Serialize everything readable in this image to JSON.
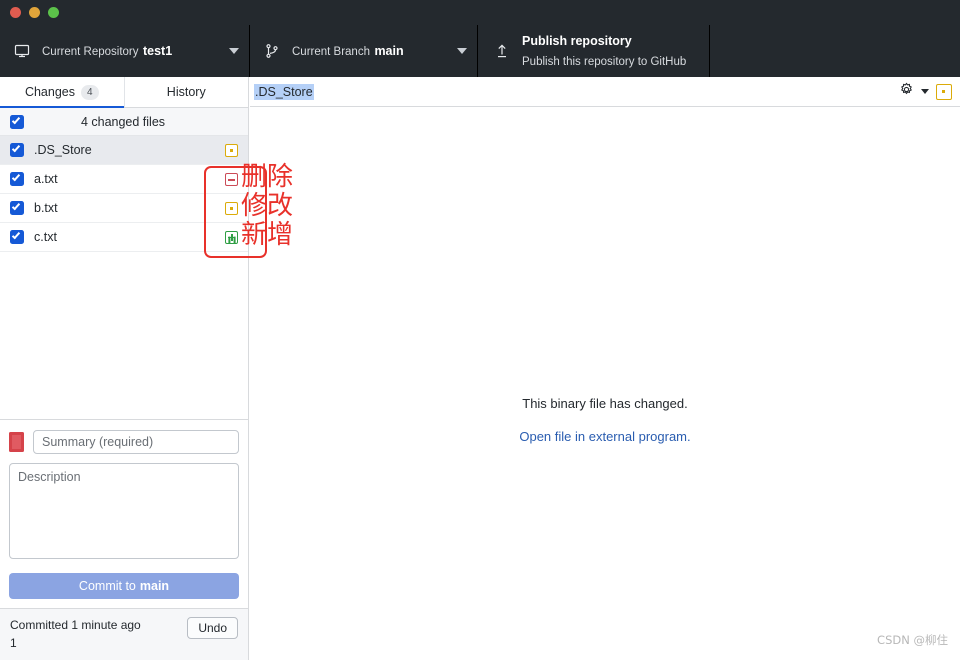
{
  "window": {
    "traffic_lights": [
      {
        "name": "close",
        "color": "#e05c50"
      },
      {
        "name": "minimize",
        "color": "#e0a43a"
      },
      {
        "name": "maximize",
        "color": "#5cc24a"
      }
    ]
  },
  "toolbar": {
    "repository": {
      "icon": "desktop-icon",
      "label": "Current Repository",
      "value": "test1"
    },
    "branch": {
      "icon": "git-branch-icon",
      "label": "Current Branch",
      "value": "main"
    },
    "publish": {
      "icon": "upload-icon",
      "title": "Publish repository",
      "subtitle": "Publish this repository to GitHub"
    }
  },
  "sidebar": {
    "tabs": [
      {
        "label": "Changes",
        "badge": "4",
        "active": true
      },
      {
        "label": "History",
        "badge": "",
        "active": false
      }
    ],
    "changed_header": "4 changed files",
    "files": [
      {
        "name": ".DS_Store",
        "status": "modified",
        "selected": true
      },
      {
        "name": "a.txt",
        "status": "deleted",
        "selected": false
      },
      {
        "name": "b.txt",
        "status": "modified",
        "selected": false
      },
      {
        "name": "c.txt",
        "status": "added",
        "selected": false
      }
    ],
    "commit": {
      "summary_placeholder": "Summary (required)",
      "summary_value": "",
      "description_placeholder": "Description",
      "description_value": "",
      "button_prefix": "Commit to",
      "button_branch": "main"
    },
    "footer": {
      "status": "Committed 1 minute ago",
      "detail": "1",
      "undo_label": "Undo"
    }
  },
  "main": {
    "diff_header": {
      "path": ".DS_Store",
      "gear_icon": "gear-icon",
      "caret_icon": "chevron-down-icon",
      "status_icon": "modified-status-icon"
    },
    "binary_message": "This binary file has changed.",
    "binary_link": "Open file in external program."
  },
  "annotations": {
    "delete_label": "删除",
    "modify_label": "修改",
    "add_label": "新增",
    "box_color": "#e8312a"
  },
  "watermark": "CSDN @柳住"
}
